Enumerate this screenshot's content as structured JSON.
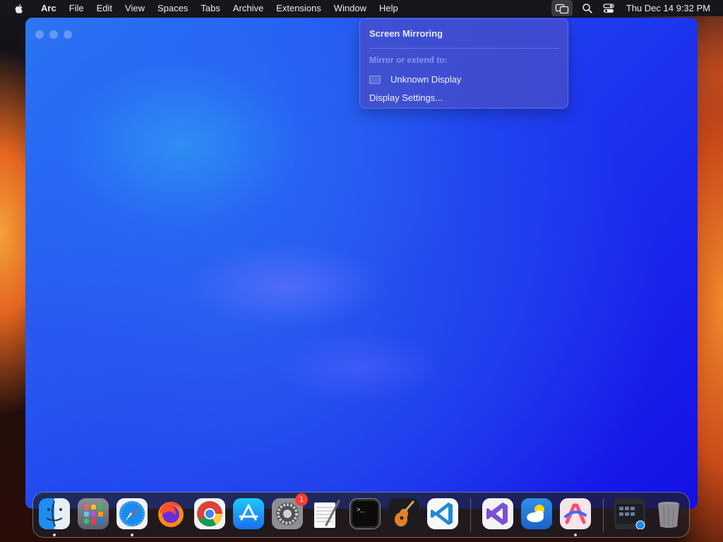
{
  "menubar": {
    "apple_icon": "apple-logo-icon",
    "app_name": "Arc",
    "items": [
      "File",
      "Edit",
      "View",
      "Spaces",
      "Tabs",
      "Archive",
      "Extensions",
      "Window",
      "Help"
    ],
    "status_icons": [
      "screen-mirroring-icon",
      "spotlight-search-icon",
      "control-center-icon"
    ],
    "clock": "Thu Dec 14  9:32 PM"
  },
  "window": {
    "app": "Arc",
    "traffic_lights": [
      "close",
      "minimize",
      "zoom"
    ]
  },
  "screen_mirroring_menu": {
    "title": "Screen Mirroring",
    "section_label": "Mirror or extend to:",
    "display_name": "Unknown Display",
    "settings_label": "Display Settings..."
  },
  "dock": {
    "apps": [
      {
        "name": "Finder",
        "icon": "finder-icon",
        "running": true
      },
      {
        "name": "Launchpad",
        "icon": "launchpad-icon",
        "running": false
      },
      {
        "name": "Safari",
        "icon": "safari-icon",
        "running": true
      },
      {
        "name": "Firefox",
        "icon": "firefox-icon",
        "running": false
      },
      {
        "name": "Google Chrome",
        "icon": "chrome-icon",
        "running": false
      },
      {
        "name": "App Store",
        "icon": "app-store-icon",
        "running": false
      },
      {
        "name": "System Settings",
        "icon": "system-settings-icon",
        "running": false,
        "badge": "1"
      },
      {
        "name": "TextEdit",
        "icon": "textedit-icon",
        "running": false
      },
      {
        "name": "Terminal",
        "icon": "terminal-icon",
        "running": false
      },
      {
        "name": "GarageBand",
        "icon": "garageband-icon",
        "running": false
      },
      {
        "name": "Visual Studio Code",
        "icon": "vscode-icon",
        "running": false
      },
      {
        "name": "Visual Studio",
        "icon": "visual-studio-icon",
        "running": false
      },
      {
        "name": "Weather",
        "icon": "weather-icon",
        "running": false
      },
      {
        "name": "Arc",
        "icon": "arc-icon",
        "running": true
      }
    ],
    "stack": {
      "name": "Downloads",
      "icon": "downloads-stack-icon"
    },
    "trash": {
      "name": "Trash",
      "icon": "trash-icon"
    },
    "badge_color": "#ff3b30"
  }
}
